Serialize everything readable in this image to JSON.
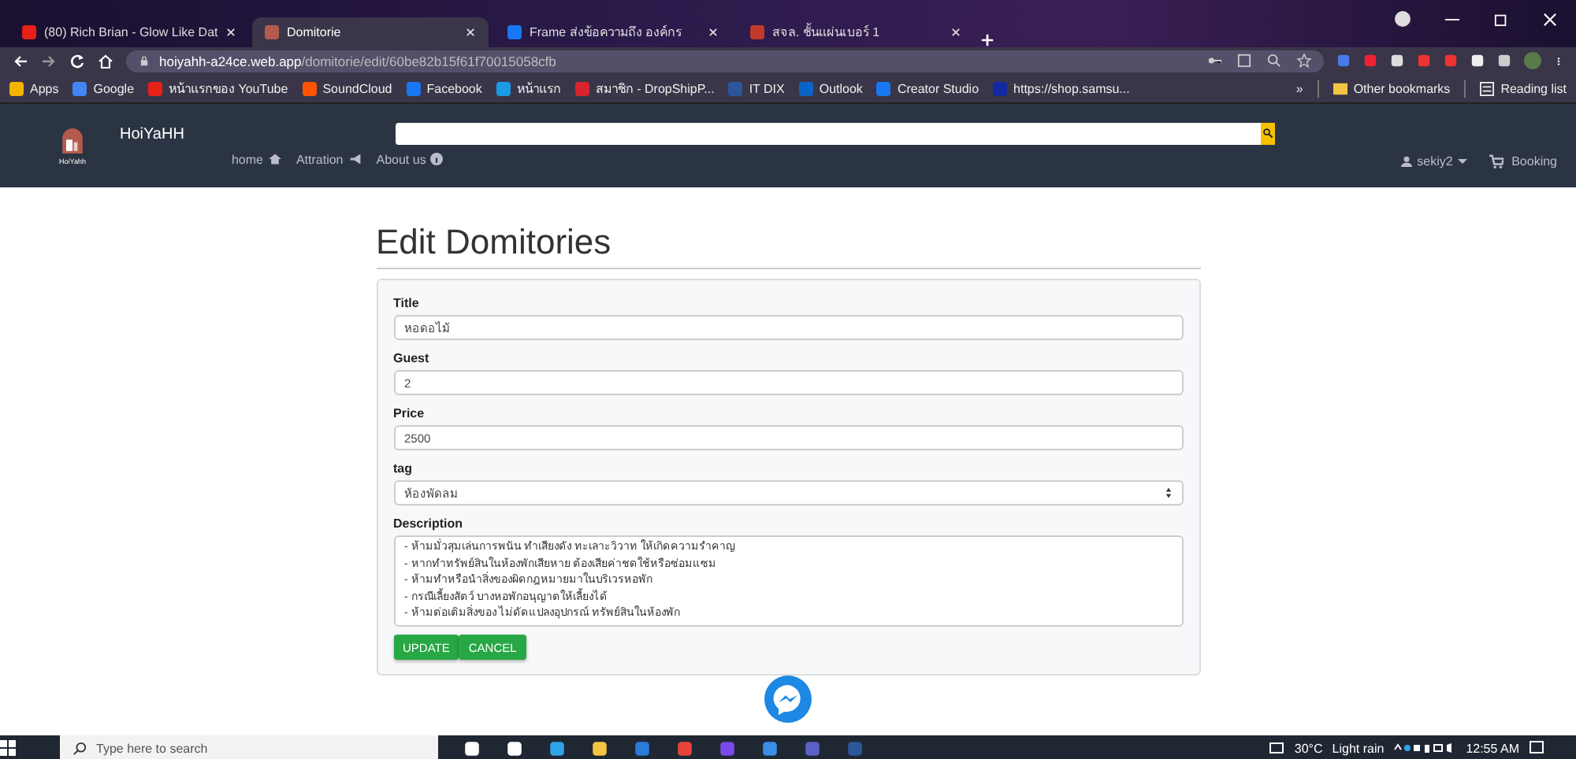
{
  "browser": {
    "tabs": [
      {
        "title": "(80) Rich Brian - Glow Like Dat",
        "selected": false,
        "color": "#e62117"
      },
      {
        "title": "Domitorie",
        "selected": true,
        "color": "#b35a4f"
      },
      {
        "title": "Frame ส่งข้อความถึง องค์กร",
        "selected": false,
        "color": "#1877f2"
      },
      {
        "title": "สจล. ชั้นแผ่นเบอร์ 1",
        "selected": false,
        "color": "#c0392b"
      }
    ],
    "address": {
      "host": "hoiyahh-a24ce.web.app",
      "path": "/domitorie/edit/60be82b15f61f70015058cfb"
    },
    "bookmarks": [
      {
        "label": "Apps",
        "color": "#f4b400"
      },
      {
        "label": "Google",
        "color": "#4285f4"
      },
      {
        "label": "หน้าแรกของ YouTube",
        "color": "#e62117"
      },
      {
        "label": "SoundCloud",
        "color": "#ff5500"
      },
      {
        "label": "Facebook",
        "color": "#1877f2"
      },
      {
        "label": "หน้าแรก",
        "color": "#1a9be6"
      },
      {
        "label": "สมาชิก - DropShipP...",
        "color": "#d9232d"
      },
      {
        "label": "IT DIX",
        "color": "#2b579a"
      },
      {
        "label": "Outlook",
        "color": "#0a64c8"
      },
      {
        "label": "Creator Studio",
        "color": "#1877f2"
      },
      {
        "label": "https://shop.samsu...",
        "color": "#1428a0"
      }
    ],
    "more": "»",
    "other_bookmarks": "Other bookmarks",
    "reading_list": "Reading list"
  },
  "navbar": {
    "logo_caption": "HoiYahh",
    "brand": "HoiYaHH",
    "links": [
      "home",
      "Attration",
      "About us"
    ],
    "user": "sekiy2",
    "booking": "Booking"
  },
  "page": {
    "heading": "Edit Domitories",
    "fields": [
      {
        "label": "Title",
        "kind": "text",
        "value": "หอดอไม้"
      },
      {
        "label": "Guest",
        "kind": "text",
        "value": "2"
      },
      {
        "label": "Price",
        "kind": "text",
        "value": "2500"
      },
      {
        "label": "tag",
        "kind": "select",
        "value": "ห้องพัดลม"
      },
      {
        "label": "Description",
        "kind": "textarea",
        "value": "- ห้ามมั่วสุมเล่นการพนัน ทำเสียงดัง ทะเลาะวิวาท ให้เกิดความรำคาญ\n- หากทำทรัพย์สินในห้องพักเสียหาย ต้องเสียค่าชดใช้หรือซ่อมแซม\n- ห้ามทำหรือนำสิ่งของผิดกฎหมายมาในบริเวรหอพัก\n- กรณีเลี้ยงสัตว์ บางหอพักอนุญาตให้เลี้ยงได้\n- ห้ามต่อเติมสิ่งของ ไม่ดัดแปลงอุปกรณ์ ทรัพย์สินในห้องพัก"
      }
    ],
    "buttons": [
      "UPDATE",
      "CANCEL"
    ]
  },
  "taskbar": {
    "search": {
      "placeholder": "Type here to search"
    },
    "temperature": "30°C",
    "weather": "Light rain",
    "time": "12:55 AM"
  }
}
